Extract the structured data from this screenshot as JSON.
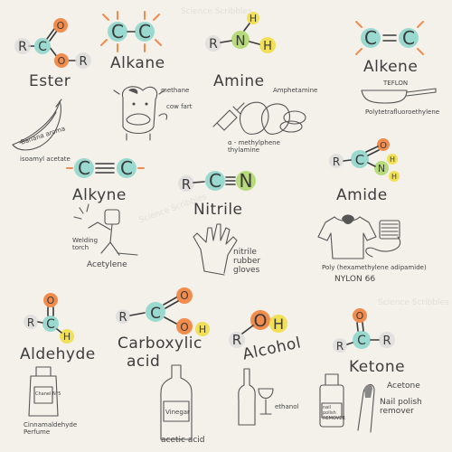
{
  "watermark": "Science Scribbles",
  "colors": {
    "background": "#f3f1ea",
    "carbon": "#9ad9cf",
    "oxygen": "#f28c4d",
    "nitrogen": "#b7da7a",
    "hydrogen": "#f1df55",
    "r_group": "#d9d9d9"
  },
  "ester": {
    "title": "Ester",
    "formula": [
      "R",
      "C",
      "O",
      "O",
      "R"
    ],
    "caption": "isoamyl acetate",
    "banana_label": "Banana aroma"
  },
  "alkane": {
    "title": "Alkane",
    "formula": [
      "C",
      "C"
    ],
    "caption": "cow fart",
    "methane_label": "methane"
  },
  "amine": {
    "title": "Amine",
    "formula": [
      "R",
      "N",
      "H",
      "H"
    ],
    "side_label": "Amphetamine",
    "caption": "α - methylphene thylamine"
  },
  "alkene": {
    "title": "Alkene",
    "formula": [
      "C",
      "C"
    ],
    "teflon_label": "TEFLON",
    "caption": "Polytetrafluoroethylene"
  },
  "alkyne": {
    "title": "Alkyne",
    "formula": [
      "C",
      "C"
    ],
    "torch_label": "Welding torch",
    "caption": "Acetylene"
  },
  "nitrile": {
    "title": "Nitrile",
    "formula": [
      "R",
      "C",
      "N"
    ],
    "caption": "nitrile rubber gloves"
  },
  "amide": {
    "title": "Amide",
    "formula": [
      "R",
      "C",
      "O",
      "N",
      "H",
      "H"
    ],
    "caption": "Poly (hexamethylene adipamide)",
    "caption2": "NYLON 66"
  },
  "aldehyde": {
    "title": "Aldehyde",
    "formula": [
      "R",
      "C",
      "O",
      "H"
    ],
    "bottle_label": "Chanel N°5",
    "caption": "Cinnamaldehyde Perfume"
  },
  "carboxylic": {
    "title_line1": "Carboxylic",
    "title_line2": "acid",
    "formula": [
      "R",
      "C",
      "O",
      "O",
      "H"
    ],
    "bottle_label": "Vinegar",
    "caption": "acetic acid"
  },
  "alcohol": {
    "title": "Alcohol",
    "formula": [
      "R",
      "O",
      "H"
    ],
    "caption": "ethanol"
  },
  "ketone": {
    "title": "Ketone",
    "formula": [
      "R",
      "C",
      "O",
      "R"
    ],
    "bottle_label": "nail polish REMOVER",
    "caption": "Acetone",
    "caption2": "Nail polish remover"
  }
}
